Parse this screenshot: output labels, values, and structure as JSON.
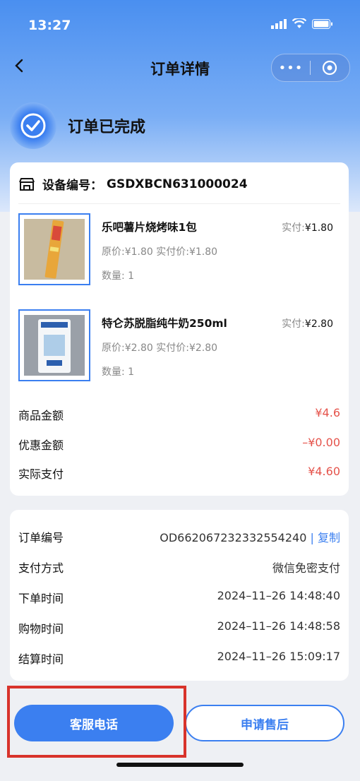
{
  "status_bar": {
    "time": "13:27"
  },
  "nav": {
    "title": "订单详情",
    "back_icon": "chevron-left-icon",
    "more_label": "•••"
  },
  "order_status": {
    "text": "订单已完成"
  },
  "device": {
    "label": "设备编号：",
    "value": "GSDXBCN631000024"
  },
  "items": [
    {
      "name": "乐吧薯片烧烤味1包",
      "paid_label": "实付:",
      "paid_value": "¥1.80",
      "price_text": "原价:¥1.80  实付价:¥1.80",
      "qty_text": "数量: 1"
    },
    {
      "name": "特仑苏脱脂纯牛奶250ml",
      "paid_label": "实付:",
      "paid_value": "¥2.80",
      "price_text": "原价:¥2.80  实付价:¥2.80",
      "qty_text": "数量: 1"
    }
  ],
  "summary": [
    {
      "label": "商品金额",
      "value": "¥4.6"
    },
    {
      "label": "优惠金额",
      "value": "–¥0.00"
    },
    {
      "label": "实际支付",
      "value": "¥4.60"
    }
  ],
  "info": {
    "order_no_label": "订单编号",
    "order_no_value": "OD662067232332554240",
    "copy_label": "复制",
    "rows": [
      {
        "label": "支付方式",
        "value": "微信免密支付"
      },
      {
        "label": "下单时间",
        "value": "2024–11–26 14:48:40"
      },
      {
        "label": "购物时间",
        "value": "2024–11–26 14:48:58"
      },
      {
        "label": "结算时间",
        "value": "2024–11–26 15:09:17"
      }
    ]
  },
  "actions": {
    "service_label": "客服电话",
    "after_sale_label": "申请售后"
  },
  "colors": {
    "accent": "#3b7ff0",
    "price": "#e5534b",
    "highlight": "#d8332b"
  }
}
